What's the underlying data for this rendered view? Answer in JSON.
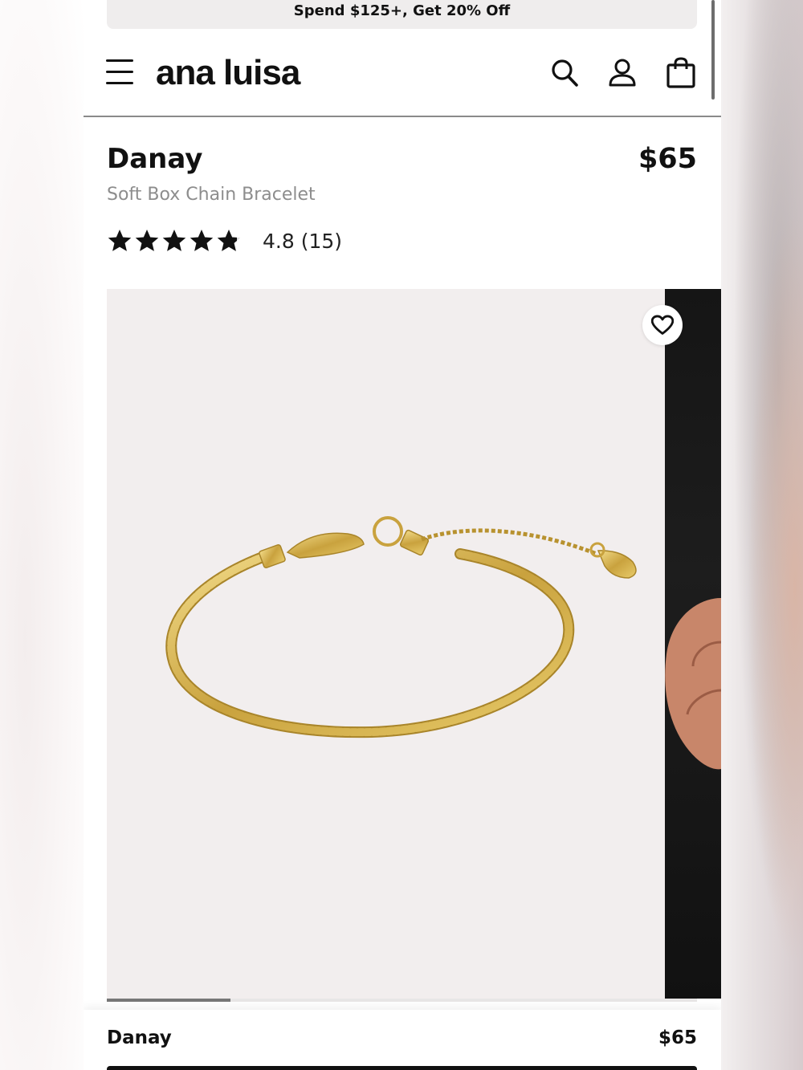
{
  "promo": {
    "text": "Spend $125+, Get 20% Off"
  },
  "header": {
    "brand": "ana luisa",
    "icons": [
      "menu-icon",
      "search-icon",
      "account-icon",
      "shopping-bag-icon"
    ]
  },
  "product": {
    "name": "Danay",
    "price": "$65",
    "subtitle": "Soft Box Chain Bracelet",
    "rating": {
      "value": 4.8,
      "count": 15,
      "text": "4.8 (15)",
      "stars_filled": 4.8,
      "stars_total": 5
    }
  },
  "gallery": {
    "wishlist_icon": "heart-icon",
    "image": "gold box chain bracelet",
    "progress": 0.21
  },
  "sticky": {
    "name": "Danay",
    "price": "$65"
  },
  "colors": {
    "gallery_bg": "#f2eeee",
    "gold": "#d4b24c",
    "text": "#111111",
    "muted": "#8d8d8d"
  }
}
